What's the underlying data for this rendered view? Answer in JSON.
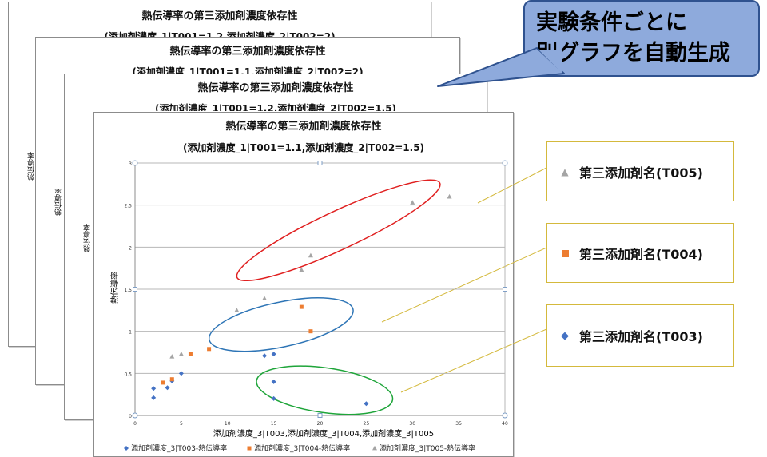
{
  "callout": {
    "line1": "実験条件ごとに",
    "line2": "別グラフを自動生成"
  },
  "sheets": [
    {
      "title": "熱伝導率の第三添加剤濃度依存性",
      "subtitle": "(添加剤濃度_1|T001=1.2,添加剤濃度_2|T002=2)",
      "ylabel": "熱伝導率"
    },
    {
      "title": "熱伝導率の第三添加剤濃度依存性",
      "subtitle": "(添加剤濃度_1|T001=1.1,添加剤濃度_2|T002=2)",
      "ylabel": "熱伝導率"
    },
    {
      "title": "熱伝導率の第三添加剤濃度依存性",
      "subtitle": "(添加剤濃度_1|T001=1.2,添加剤濃度_2|T002=1.5)",
      "ylabel": "熱伝導率"
    }
  ],
  "legend_boxes": {
    "t005": "第三添加剤名(T005)",
    "t004": "第三添加剤名(T004)",
    "t003": "第三添加剤名(T003)"
  },
  "colors": {
    "t003": "#4472c4",
    "t004": "#ed7d31",
    "t005": "#a5a5a5",
    "ellipse_red": "#e02020",
    "ellipse_blue": "#2e75b6",
    "ellipse_green": "#1fa53a",
    "callout_fill": "#8eaadc"
  },
  "chart_data": {
    "type": "scatter",
    "title": "熱伝導率の第三添加剤濃度依存性",
    "subtitle": "(添加剤濃度_1|T001=1.1,添加剤濃度_2|T002=1.5)",
    "xlabel": "添加剤濃度_3|T003,添加剤濃度_3|T004,添加剤濃度_3|T005",
    "ylabel": "熱伝導率",
    "xlim": [
      0,
      40
    ],
    "ylim": [
      0,
      3
    ],
    "xticks": [
      0,
      5,
      10,
      15,
      20,
      25,
      30,
      35,
      40
    ],
    "yticks": [
      0,
      0.5,
      1,
      1.5,
      2,
      2.5,
      3
    ],
    "grid": true,
    "legend_position": "bottom",
    "series": [
      {
        "name": "添加剤濃度_3|T003-熱伝導率",
        "marker": "diamond",
        "points": [
          [
            2,
            0.21
          ],
          [
            2,
            0.32
          ],
          [
            3.5,
            0.33
          ],
          [
            4,
            0.41
          ],
          [
            5,
            0.5
          ],
          [
            14,
            0.71
          ],
          [
            15,
            0.73
          ],
          [
            15,
            0.4
          ],
          [
            15,
            0.2
          ],
          [
            25,
            0.14
          ]
        ]
      },
      {
        "name": "添加剤濃度_3|T004-熱伝導率",
        "marker": "square",
        "points": [
          [
            3,
            0.39
          ],
          [
            4,
            0.43
          ],
          [
            6,
            0.73
          ],
          [
            8,
            0.79
          ],
          [
            18,
            1.29
          ],
          [
            19,
            1.0
          ]
        ]
      },
      {
        "name": "添加剤濃度_3|T005-熱伝導率",
        "marker": "triangle",
        "points": [
          [
            4,
            0.7
          ],
          [
            5,
            0.73
          ],
          [
            11,
            1.25
          ],
          [
            14,
            1.39
          ],
          [
            18,
            1.73
          ],
          [
            19,
            1.9
          ],
          [
            30,
            2.53
          ],
          [
            34,
            2.6
          ]
        ]
      }
    ]
  }
}
